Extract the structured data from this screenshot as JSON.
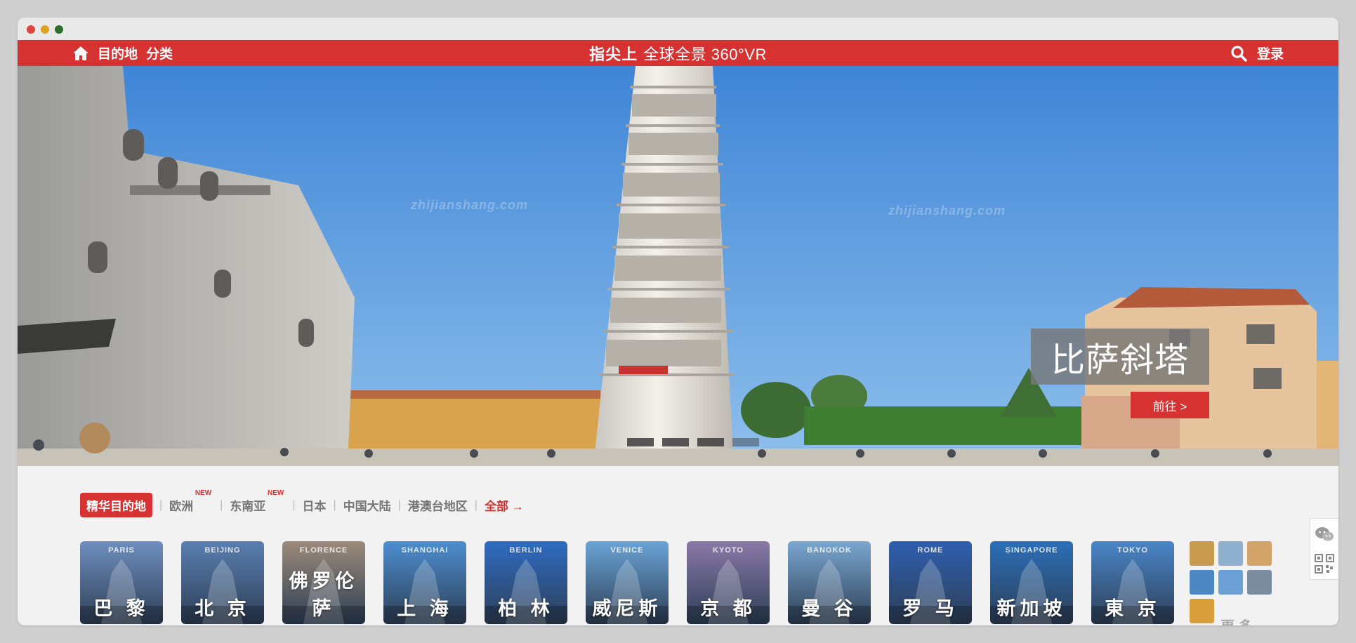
{
  "nav": {
    "destinations": "目的地",
    "categories": "分类",
    "brand": "指尖上",
    "tagline": "全球全景 360°VR",
    "login": "登录"
  },
  "hero": {
    "title": "比萨斜塔",
    "goto_label": "前往 >",
    "watermark": "zhijianshang.com",
    "slides": 4,
    "active_slide": 4
  },
  "tabs": [
    {
      "label": "精华目的地",
      "active": true
    },
    {
      "label": "欧洲",
      "badge": "NEW"
    },
    {
      "label": "东南亚",
      "badge": "NEW"
    },
    {
      "label": "日本"
    },
    {
      "label": "中国大陆"
    },
    {
      "label": "港澳台地区"
    },
    {
      "label": "全部 →",
      "all": true
    }
  ],
  "destinations": [
    {
      "en": "PARIS",
      "zh": "巴 黎",
      "color": "#6f8fbf"
    },
    {
      "en": "BEIJING",
      "zh": "北 京",
      "color": "#5a7fb0"
    },
    {
      "en": "FLORENCE",
      "zh": "佛罗伦萨",
      "color": "#9c8a7a"
    },
    {
      "en": "SHANGHAI",
      "zh": "上 海",
      "color": "#4d8ed0"
    },
    {
      "en": "BERLIN",
      "zh": "柏 林",
      "color": "#2f6cc2"
    },
    {
      "en": "VENICE",
      "zh": "威尼斯",
      "color": "#6aa4d6"
    },
    {
      "en": "KYOTO",
      "zh": "京 都",
      "color": "#8a79a8"
    },
    {
      "en": "BANGKOK",
      "zh": "曼 谷",
      "color": "#7aa7d0"
    },
    {
      "en": "ROME",
      "zh": "罗 马",
      "color": "#2f5fb0"
    },
    {
      "en": "SINGAPORE",
      "zh": "新加坡",
      "color": "#2b6fb8"
    },
    {
      "en": "TOKYO",
      "zh": "東 京",
      "color": "#4a86c8"
    }
  ],
  "more": {
    "label": "更 多..."
  }
}
